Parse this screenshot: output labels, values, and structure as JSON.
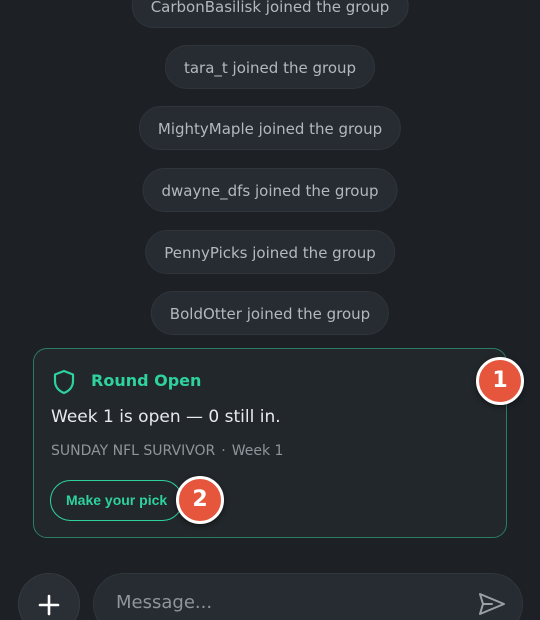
{
  "system_messages": [
    "CarbonBasilisk joined the group",
    "tara_t joined the group",
    "MightyMaple joined the group",
    "dwayne_dfs joined the group",
    "PennyPicks joined the group",
    "BoldOtter joined the group"
  ],
  "round_card": {
    "icon": "shield-icon",
    "title": "Round Open",
    "body": "Week 1 is open — 0 still in.",
    "league": "SUNDAY NFL SURVIVOR",
    "separator": "·",
    "week": "Week 1",
    "button_label": "Make your pick"
  },
  "badges": [
    "1",
    "2"
  ],
  "composer": {
    "add_icon": "plus-icon",
    "placeholder": "Message...",
    "send_icon": "send-icon"
  },
  "colors": {
    "background": "#1d2126",
    "accent": "#2ed39c",
    "badge": "#e5563d"
  }
}
